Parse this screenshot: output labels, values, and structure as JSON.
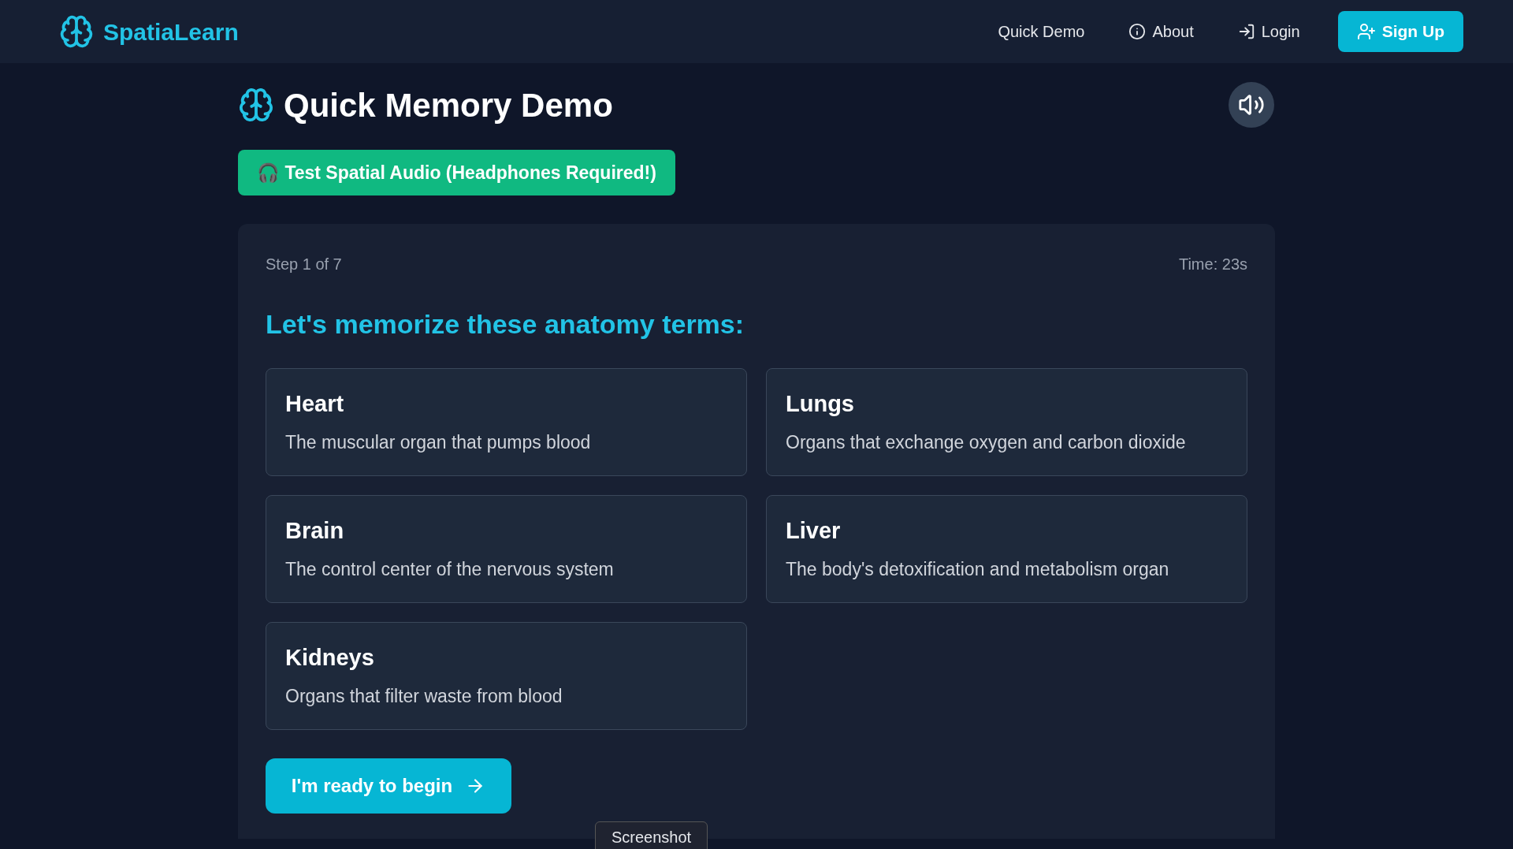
{
  "brand": "SpatiaLearn",
  "nav": [
    {
      "label": "Quick Demo",
      "kind": "plain"
    },
    {
      "label": "About",
      "kind": "info"
    },
    {
      "label": "Login",
      "kind": "login"
    },
    {
      "label": "Sign Up",
      "kind": "signup"
    }
  ],
  "title": "Quick Memory Demo",
  "audio_test_button": "🎧 Test Spatial Audio (Headphones Required!)",
  "step": "Step 1 of 7",
  "time": "Time: 23s",
  "heading": "Let's memorize these anatomy terms:",
  "terms": [
    {
      "term": "Heart",
      "definition": "The muscular organ that pumps blood"
    },
    {
      "term": "Lungs",
      "definition": "Organs that exchange oxygen and carbon dioxide"
    },
    {
      "term": "Brain",
      "definition": "The control center of the nervous system"
    },
    {
      "term": "Liver",
      "definition": "The body's detoxification and metabolism organ"
    },
    {
      "term": "Kidneys",
      "definition": "Organs that filter waste from blood"
    }
  ],
  "start_button": "I'm ready to begin",
  "tooltip": "Screenshot"
}
